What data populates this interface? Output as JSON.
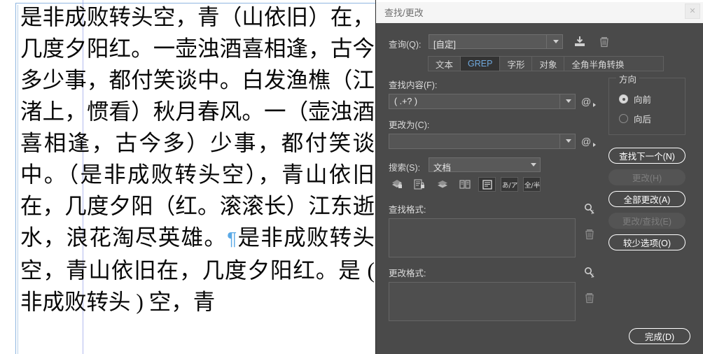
{
  "document": {
    "name": "indesign-document-text",
    "lines": [
      "是非成败转头空，青（山依旧）在，几度夕阳红。一壶浊酒喜相逢，古今多少事，都付笑谈中。白发渔樵（江渚上，惯看）秋月春风。一（壶浊酒喜相逢，古今多）少事，都付笑谈中。（是非成败转头空），青山依旧在，几度夕阳（红。滚滚长）江东逝水，浪花淘尽英雄。",
      "是非成败转头空，青山依旧在，几度夕阳红。是 ( 非成败转头 ) 空，青"
    ],
    "pilcrow": "¶"
  },
  "dialog": {
    "title": "查找/更改",
    "close_label": "✕",
    "query": {
      "label": "查询(Q):",
      "value": "[自定]",
      "save_icon": "save-query-icon",
      "delete_icon": "delete-query-icon"
    },
    "tabs": [
      {
        "label": "文本",
        "active": false
      },
      {
        "label": "GREP",
        "active": true
      },
      {
        "label": "字形",
        "active": false
      },
      {
        "label": "对象",
        "active": false
      },
      {
        "label": "全角半角转换",
        "active": false
      }
    ],
    "find_what": {
      "label": "查找内容(F):",
      "value": "( .+? )",
      "special_btn": "@"
    },
    "change_to": {
      "label": "更改为(C):",
      "value": "",
      "special_btn": "@"
    },
    "search_scope": {
      "label": "搜索(S):",
      "value": "文档"
    },
    "toggles": [
      {
        "name": "case-sensitive-icon",
        "on": false
      },
      {
        "name": "whole-word-icon",
        "on": false
      },
      {
        "name": "include-locked-layers-icon",
        "on": false
      },
      {
        "name": "include-locked-stories-icon",
        "on": false
      },
      {
        "name": "include-hidden-layers-icon",
        "on": true
      },
      {
        "name": "include-master-pages-icon",
        "on": true
      },
      {
        "name": "include-footnotes-icon",
        "on": true
      }
    ],
    "find_format": {
      "label": "查找格式:",
      "value": "",
      "find_icon": "specify-attributes-icon",
      "clear_icon": "clear-format-icon"
    },
    "change_format": {
      "label": "更改格式:",
      "value": "",
      "find_icon": "specify-attributes-icon",
      "clear_icon": "clear-format-icon"
    },
    "direction": {
      "legend": "方向",
      "options": [
        {
          "label": "向前",
          "selected": true
        },
        {
          "label": "向后",
          "selected": false
        }
      ]
    },
    "buttons": [
      {
        "label": "查找下一个(N)",
        "disabled": false
      },
      {
        "label": "更改(H)",
        "disabled": true
      },
      {
        "label": "全部更改(A)",
        "disabled": false
      },
      {
        "label": "更改/查找(E)",
        "disabled": true
      },
      {
        "label": "较少选项(O)",
        "disabled": false
      }
    ],
    "done_button": {
      "label": "完成(D)"
    }
  },
  "colors": {
    "dialog_bg": "#4a4a4a",
    "titlebar_bg": "#f5f5f5",
    "tab_active_text": "#6fa8dc",
    "frame_blue": "#8fb6e0",
    "pilcrow_blue": "#5aa9e6"
  }
}
